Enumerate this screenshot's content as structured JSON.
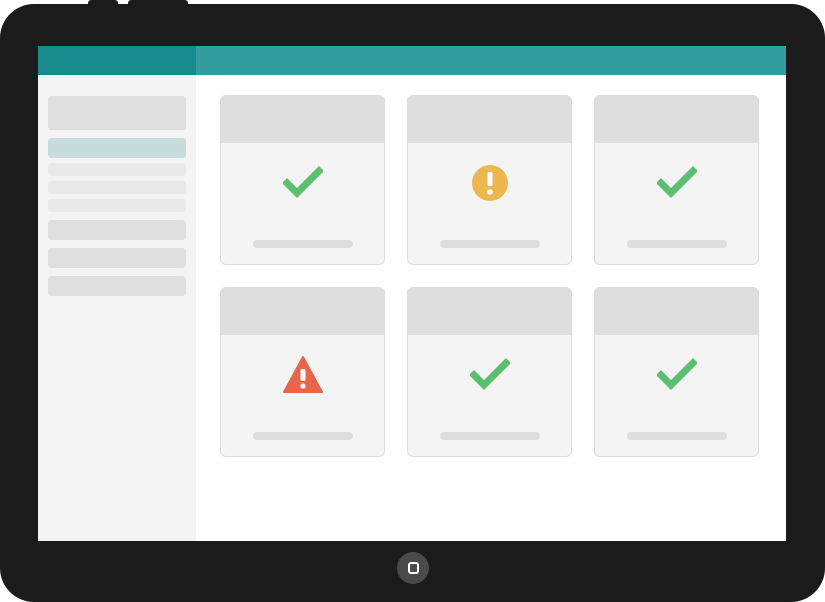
{
  "device": {
    "home_button_icon": "home-icon"
  },
  "header": {
    "brand_color": "#178a8e",
    "bar_color": "#339c9f"
  },
  "sidebar": {
    "items": [
      {
        "kind": "header",
        "label": ""
      },
      {
        "kind": "active",
        "label": ""
      },
      {
        "kind": "sub",
        "label": ""
      },
      {
        "kind": "sub",
        "label": ""
      },
      {
        "kind": "sub",
        "label": ""
      },
      {
        "kind": "item",
        "label": ""
      },
      {
        "kind": "item",
        "label": ""
      },
      {
        "kind": "item",
        "label": ""
      }
    ]
  },
  "cards": [
    {
      "status": "ok",
      "icon": "checkmark-icon",
      "color": "#5cbf6f",
      "title": "",
      "caption": ""
    },
    {
      "status": "warning",
      "icon": "exclamation-circle-icon",
      "color": "#eeb64e",
      "title": "",
      "caption": ""
    },
    {
      "status": "ok",
      "icon": "checkmark-icon",
      "color": "#5cbf6f",
      "title": "",
      "caption": ""
    },
    {
      "status": "error",
      "icon": "warning-triangle-icon",
      "color": "#e8654b",
      "title": "",
      "caption": ""
    },
    {
      "status": "ok",
      "icon": "checkmark-icon",
      "color": "#5cbf6f",
      "title": "",
      "caption": ""
    },
    {
      "status": "ok",
      "icon": "checkmark-icon",
      "color": "#5cbf6f",
      "title": "",
      "caption": ""
    }
  ]
}
